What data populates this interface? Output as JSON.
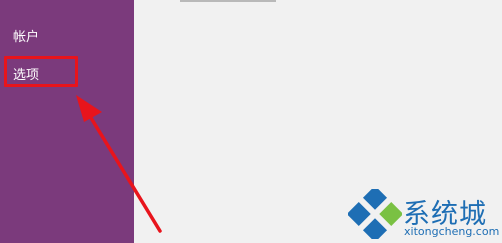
{
  "sidebar": {
    "items": [
      {
        "label": "帐户"
      },
      {
        "label": "选项"
      }
    ]
  },
  "watermark": {
    "brand": "系统城",
    "domain": "xitongcheng.com"
  },
  "colors": {
    "sidebar_bg": "#7b3a7c",
    "content_bg": "#f1f1f1",
    "highlight": "#e8141c",
    "brand_blue": "#1e6eb4",
    "logo_green": "#7ac143"
  }
}
